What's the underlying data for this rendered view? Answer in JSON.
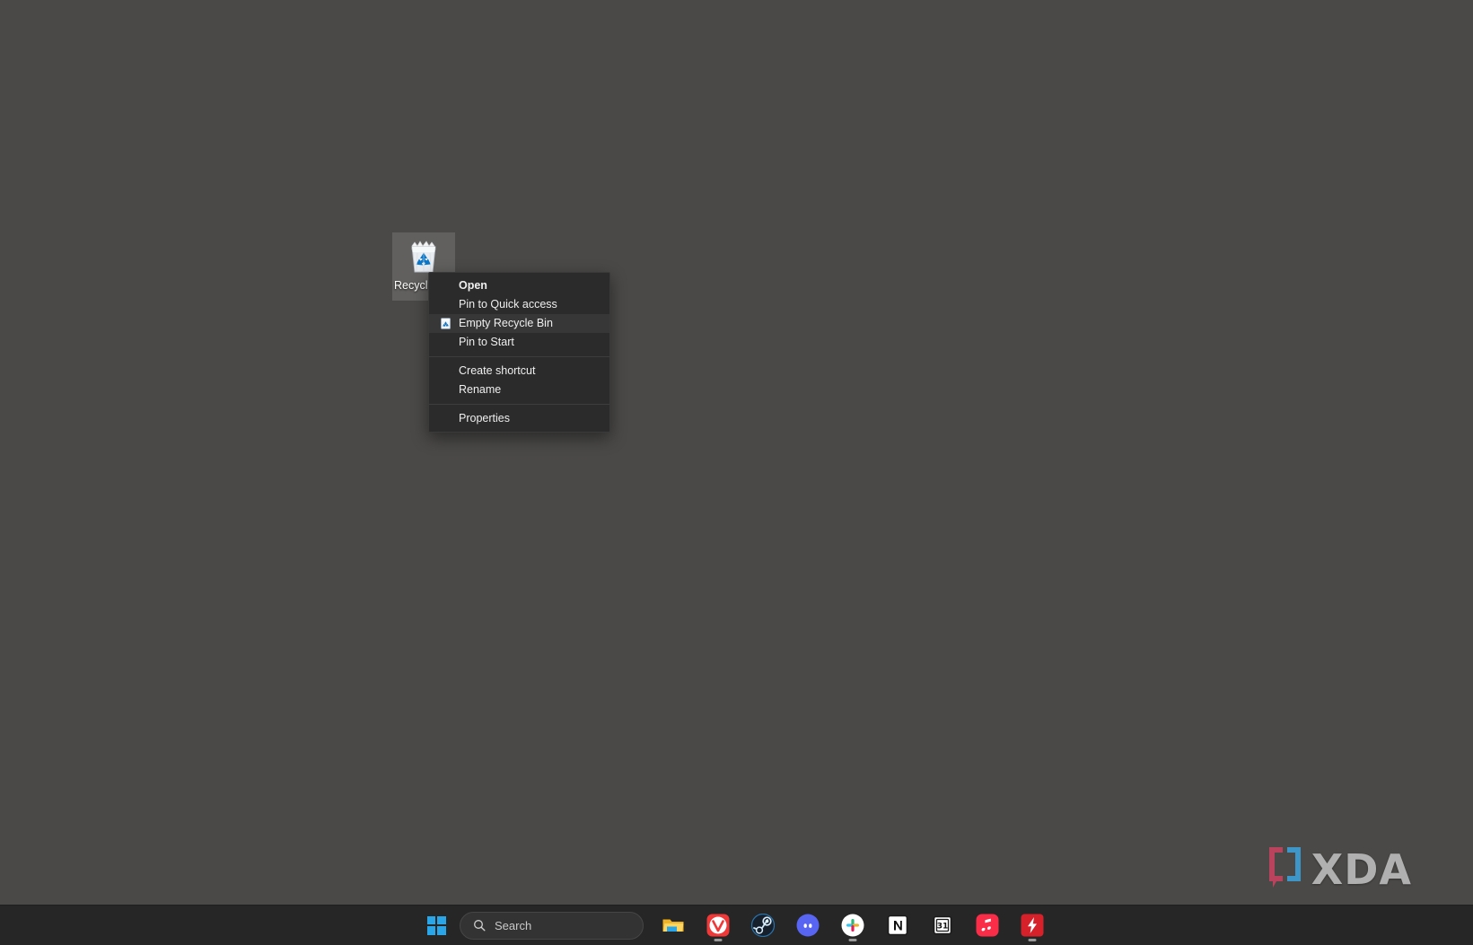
{
  "desktop": {
    "background_color": "#4a4947",
    "icons": [
      {
        "name": "recycle-bin",
        "label": "Recycle Bin",
        "icon": "recycle-bin-full-icon"
      }
    ]
  },
  "context_menu": {
    "target": "Recycle Bin",
    "groups": [
      {
        "items": [
          {
            "label": "Open",
            "bold": true,
            "icon": null,
            "highlighted": false
          },
          {
            "label": "Pin to Quick access",
            "bold": false,
            "icon": null,
            "highlighted": false
          },
          {
            "label": "Empty Recycle Bin",
            "bold": false,
            "icon": "recycle-bin-small-icon",
            "highlighted": true
          },
          {
            "label": "Pin to Start",
            "bold": false,
            "icon": null,
            "highlighted": false
          }
        ]
      },
      {
        "items": [
          {
            "label": "Create shortcut",
            "bold": false,
            "icon": null,
            "highlighted": false
          },
          {
            "label": "Rename",
            "bold": false,
            "icon": null,
            "highlighted": false
          }
        ]
      },
      {
        "items": [
          {
            "label": "Properties",
            "bold": false,
            "icon": null,
            "highlighted": false
          }
        ]
      }
    ],
    "background_color": "#2b2b2b",
    "highlight_color": "#373737"
  },
  "taskbar": {
    "background_color": "#262626",
    "start_button": {
      "name": "start-button",
      "icon": "windows-logo-icon",
      "accent": "#2aa6e8"
    },
    "search": {
      "placeholder": "Search",
      "value": "",
      "icon": "search-icon"
    },
    "apps": [
      {
        "name": "file-explorer",
        "label": "File Explorer",
        "icon": "folder-icon",
        "color": "#f5c033",
        "running": false
      },
      {
        "name": "vivaldi",
        "label": "Vivaldi",
        "icon": "vivaldi-icon",
        "color": "#ef3939",
        "running": true
      },
      {
        "name": "steam",
        "label": "Steam",
        "icon": "steam-icon",
        "color": "#1b2838",
        "running": false
      },
      {
        "name": "discord",
        "label": "Discord",
        "icon": "discord-icon",
        "color": "#5865f2",
        "running": false
      },
      {
        "name": "slack",
        "label": "Slack",
        "icon": "slack-icon",
        "color": "#ffffff",
        "running": true
      },
      {
        "name": "notion",
        "label": "Notion",
        "icon": "notion-icon",
        "color": "#ffffff",
        "running": false
      },
      {
        "name": "calendar",
        "label": "Calendar",
        "icon": "calendar-icon",
        "day_number": "31",
        "color": "#ffffff",
        "running": false
      },
      {
        "name": "apple-music",
        "label": "Apple Music",
        "icon": "music-note-icon",
        "color": "#fa2d48",
        "running": false
      },
      {
        "name": "bolt",
        "label": "Bolt",
        "icon": "lightning-bolt-icon",
        "color": "#d6202a",
        "running": true
      }
    ]
  },
  "watermark": {
    "text": "XDA",
    "bracket_left_color": "#c3425e",
    "bracket_right_color": "#3d9cd4",
    "text_color": "#b9b9b9"
  }
}
